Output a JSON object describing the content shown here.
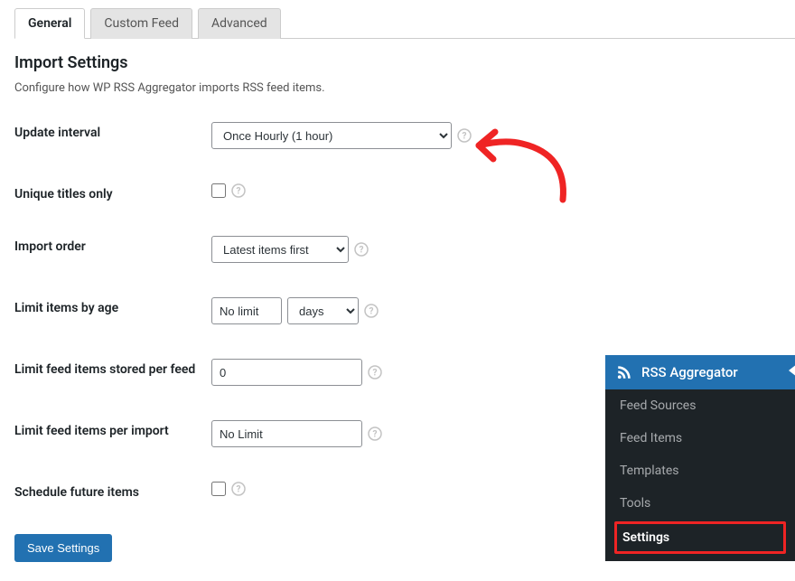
{
  "tabs": {
    "general": "General",
    "custom_feed": "Custom Feed",
    "advanced": "Advanced"
  },
  "section": {
    "title": "Import Settings",
    "description": "Configure how WP RSS Aggregator imports RSS feed items."
  },
  "fields": {
    "update_interval": {
      "label": "Update interval",
      "value": "Once Hourly (1 hour)"
    },
    "unique_titles": {
      "label": "Unique titles only"
    },
    "import_order": {
      "label": "Import order",
      "value": "Latest items first"
    },
    "limit_by_age": {
      "label": "Limit items by age",
      "value": "No limit",
      "unit": "days"
    },
    "limit_stored": {
      "label": "Limit feed items stored per feed",
      "value": "0"
    },
    "limit_per_import": {
      "label": "Limit feed items per import",
      "value": "No Limit"
    },
    "schedule_future": {
      "label": "Schedule future items"
    }
  },
  "save_button": "Save Settings",
  "side_panel": {
    "title": "RSS Aggregator",
    "items": {
      "feed_sources": "Feed Sources",
      "feed_items": "Feed Items",
      "templates": "Templates",
      "tools": "Tools",
      "settings": "Settings"
    }
  },
  "colors": {
    "primary": "#2271b1",
    "annotation": "#ef2424"
  }
}
